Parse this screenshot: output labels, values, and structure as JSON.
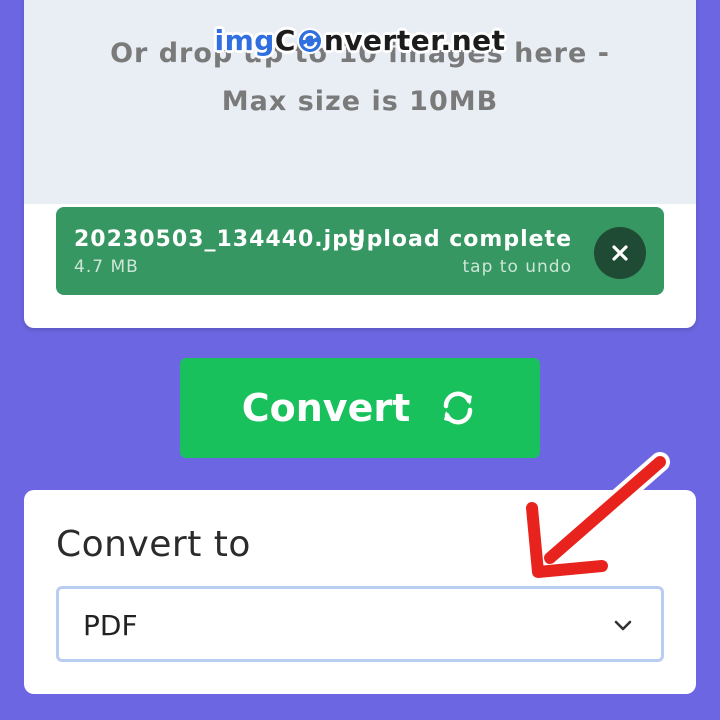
{
  "brand": {
    "part1": "img",
    "part2": "nverter.net",
    "part_c": "C"
  },
  "dropzone": {
    "line1": "Or drop up to 10 images here -",
    "line2": "Max size is 10MB"
  },
  "file": {
    "name": "20230503_134440.jpg",
    "size": "4.7 MB",
    "status": "Upload complete",
    "undo": "tap to undo"
  },
  "convert_button": {
    "label": "Convert",
    "icon": "sync-icon"
  },
  "convert_to": {
    "label": "Convert to",
    "selected": "PDF"
  },
  "colors": {
    "background": "#6c66e2",
    "file_item": "#369763",
    "convert_button": "#18c15b",
    "annotation_arrow": "#e8231e"
  }
}
